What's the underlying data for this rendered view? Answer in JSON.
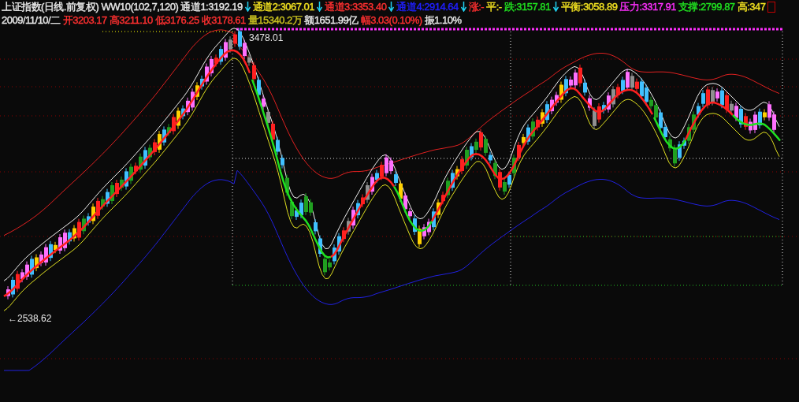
{
  "header": {
    "row_1": [
      {
        "kind": "text",
        "text": "上证指数(日线.前复权) WW10(102,7,120)",
        "color": "#e8e8e8"
      },
      {
        "kind": "text",
        "text": "通道1:3192.19",
        "color": "#e8e8e8"
      },
      {
        "kind": "arrow"
      },
      {
        "kind": "text",
        "text": "通道2:3067.01",
        "color": "#f0e020"
      },
      {
        "kind": "arrow"
      },
      {
        "kind": "text",
        "text": "通道3:3353.40",
        "color": "#ff3030"
      },
      {
        "kind": "arrow"
      },
      {
        "kind": "text",
        "text": "通道4:2914.64",
        "color": "#2020ff"
      },
      {
        "kind": "arrow"
      },
      {
        "kind": "text",
        "text": "涨:-",
        "color": "#ff3030"
      },
      {
        "kind": "text",
        "text": "平:-",
        "color": "#f0e020"
      },
      {
        "kind": "text",
        "text": "跌:3157.81",
        "color": "#20e020"
      },
      {
        "kind": "arrow"
      },
      {
        "kind": "text",
        "text": "平衡:3058.89",
        "color": "#f0e020"
      },
      {
        "kind": "text",
        "text": "压力:3317.91",
        "color": "#ff30ff"
      },
      {
        "kind": "text",
        "text": "支撑:2799.87",
        "color": "#20e020"
      },
      {
        "kind": "text",
        "text": "高:347",
        "color": "#f0e020"
      },
      {
        "kind": "box"
      }
    ],
    "row_2": [
      {
        "kind": "text",
        "text": "2009/11/10/二",
        "color": "#e8e8e8"
      },
      {
        "kind": "text",
        "text": "开3203.17",
        "color": "#ff3030"
      },
      {
        "kind": "text",
        "text": "高3211.10",
        "color": "#ff3030"
      },
      {
        "kind": "text",
        "text": "低3176.25",
        "color": "#ff3030"
      },
      {
        "kind": "text",
        "text": "收3178.61",
        "color": "#ff3030"
      },
      {
        "kind": "text",
        "text": "量15340.2万",
        "color": "#c8c020"
      },
      {
        "kind": "text",
        "text": "额1651.99亿",
        "color": "#e8e8e8"
      },
      {
        "kind": "text",
        "text": "幅3.03(0.10%)",
        "color": "#ff3030"
      },
      {
        "kind": "text",
        "text": "振1.10%",
        "color": "#e8e8e8"
      }
    ]
  },
  "chart": {
    "high_label": "3478.01",
    "low_label": "←2538.62"
  }
}
